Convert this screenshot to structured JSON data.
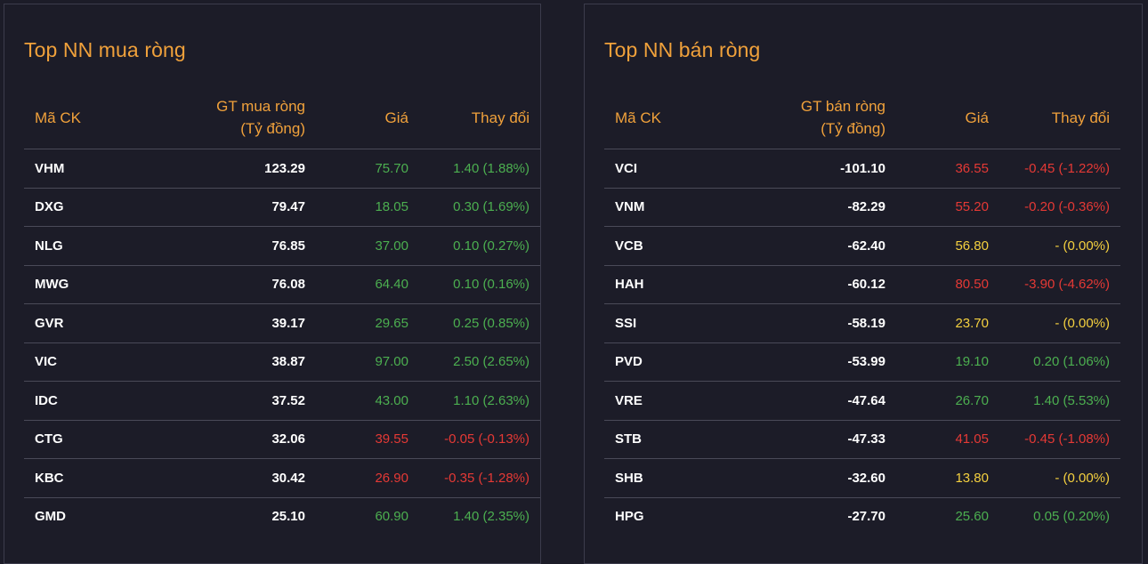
{
  "buy": {
    "title": "Top NN mua ròng",
    "headers": {
      "symbol": "Mã CK",
      "value_line1": "GT mua ròng",
      "value_line2": "(Tỷ đồng)",
      "price": "Giá",
      "change": "Thay đổi"
    },
    "rows": [
      {
        "symbol": "VHM",
        "value": "123.29",
        "price": "75.70",
        "change": "1.40 (1.88%)",
        "color": "green"
      },
      {
        "symbol": "DXG",
        "value": "79.47",
        "price": "18.05",
        "change": "0.30 (1.69%)",
        "color": "green"
      },
      {
        "symbol": "NLG",
        "value": "76.85",
        "price": "37.00",
        "change": "0.10 (0.27%)",
        "color": "green"
      },
      {
        "symbol": "MWG",
        "value": "76.08",
        "price": "64.40",
        "change": "0.10 (0.16%)",
        "color": "green"
      },
      {
        "symbol": "GVR",
        "value": "39.17",
        "price": "29.65",
        "change": "0.25 (0.85%)",
        "color": "green"
      },
      {
        "symbol": "VIC",
        "value": "38.87",
        "price": "97.00",
        "change": "2.50 (2.65%)",
        "color": "green"
      },
      {
        "symbol": "IDC",
        "value": "37.52",
        "price": "43.00",
        "change": "1.10 (2.63%)",
        "color": "green"
      },
      {
        "symbol": "CTG",
        "value": "32.06",
        "price": "39.55",
        "change": "-0.05 (-0.13%)",
        "color": "red"
      },
      {
        "symbol": "KBC",
        "value": "30.42",
        "price": "26.90",
        "change": "-0.35 (-1.28%)",
        "color": "red"
      },
      {
        "symbol": "GMD",
        "value": "25.10",
        "price": "60.90",
        "change": "1.40 (2.35%)",
        "color": "green"
      }
    ]
  },
  "sell": {
    "title": "Top NN bán ròng",
    "headers": {
      "symbol": "Mã CK",
      "value_line1": "GT bán ròng",
      "value_line2": "(Tỷ đồng)",
      "price": "Giá",
      "change": "Thay đổi"
    },
    "rows": [
      {
        "symbol": "VCI",
        "value": "-101.10",
        "price": "36.55",
        "change": "-0.45 (-1.22%)",
        "color": "red"
      },
      {
        "symbol": "VNM",
        "value": "-82.29",
        "price": "55.20",
        "change": "-0.20 (-0.36%)",
        "color": "red"
      },
      {
        "symbol": "VCB",
        "value": "-62.40",
        "price": "56.80",
        "change": "- (0.00%)",
        "color": "yellow"
      },
      {
        "symbol": "HAH",
        "value": "-60.12",
        "price": "80.50",
        "change": "-3.90 (-4.62%)",
        "color": "red"
      },
      {
        "symbol": "SSI",
        "value": "-58.19",
        "price": "23.70",
        "change": "- (0.00%)",
        "color": "yellow"
      },
      {
        "symbol": "PVD",
        "value": "-53.99",
        "price": "19.10",
        "change": "0.20 (1.06%)",
        "color": "green"
      },
      {
        "symbol": "VRE",
        "value": "-47.64",
        "price": "26.70",
        "change": "1.40 (5.53%)",
        "color": "green"
      },
      {
        "symbol": "STB",
        "value": "-47.33",
        "price": "41.05",
        "change": "-0.45 (-1.08%)",
        "color": "red"
      },
      {
        "symbol": "SHB",
        "value": "-32.60",
        "price": "13.80",
        "change": "- (0.00%)",
        "color": "yellow"
      },
      {
        "symbol": "HPG",
        "value": "-27.70",
        "price": "25.60",
        "change": "0.05 (0.20%)",
        "color": "green"
      }
    ]
  },
  "colors": {
    "accent": "#f0a13b",
    "up": "#4caf50",
    "down": "#e53935",
    "unchanged": "#f4d03f",
    "background": "#1c1c28"
  }
}
